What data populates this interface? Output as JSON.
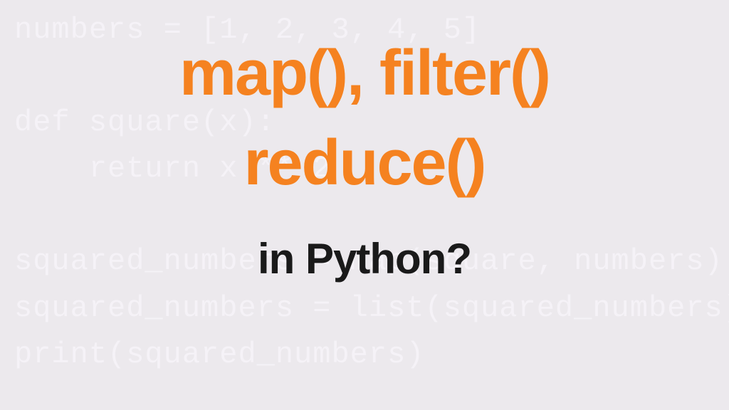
{
  "background": {
    "code": "numbers = [1, 2, 3, 4, 5]\n\ndef square(x):\n    return x ** 2\n\nsquared_numbers = map(square, numbers)\nsquared_numbers = list(squared_numbers)\nprint(squared_numbers)"
  },
  "title": {
    "line1": "map(), filter()",
    "line2": "reduce()"
  },
  "subtitle": "in Python?",
  "colors": {
    "accent": "#f58220",
    "text_dark": "#1a1a1a",
    "bg": "#ece9ed",
    "bg_code": "#f5f2f7"
  }
}
